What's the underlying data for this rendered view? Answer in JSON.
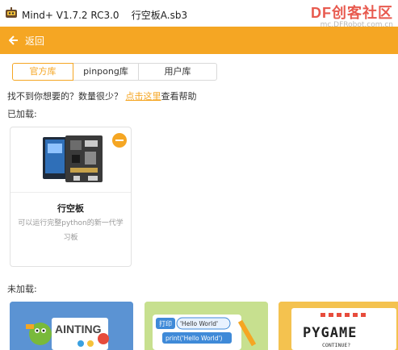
{
  "titlebar": {
    "title": "Mind+ V1.7.2 RC3.0    行空板A.sb3",
    "brand_logo": "DF创客社区",
    "brand_url": "mc.DFRobot.com.cn"
  },
  "header": {
    "back_label": "返回"
  },
  "tabs": [
    {
      "label": "官方库",
      "active": true
    },
    {
      "label": "pinpong库",
      "active": false
    },
    {
      "label": "用户库",
      "active": false
    }
  ],
  "help": {
    "prefix": "找不到你想要的？数量很少？ ",
    "link": "点击这里",
    "suffix": "查看帮助"
  },
  "loaded": {
    "label": "已加载:",
    "cards": [
      {
        "name": "行空板",
        "description": "可以运行完整python的新一代学习板"
      }
    ]
  },
  "unloaded": {
    "label": "未加载:",
    "cards": [
      {
        "banner_text": "AINTING"
      },
      {
        "banner_text_1": "打印",
        "banner_text_2": "'Hello World'",
        "banner_text_3": "print('Hello World')"
      },
      {
        "banner_text": "PYGAME",
        "banner_sub": "CONTINUE?"
      }
    ]
  },
  "colors": {
    "accent": "#f5a623",
    "brand": "#e85a4f"
  }
}
